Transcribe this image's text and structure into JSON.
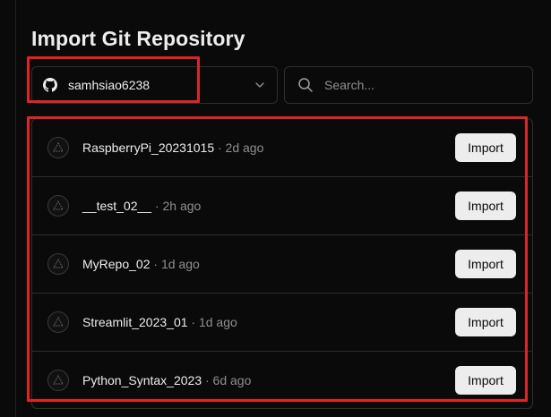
{
  "page": {
    "title": "Import Git Repository"
  },
  "account_select": {
    "value": "samhsiao6238",
    "icon": "github-icon"
  },
  "search": {
    "placeholder": "Search..."
  },
  "highlight_color": "#e02424",
  "repos": [
    {
      "name": "RaspberryPi_20231015",
      "meta": "· 2d ago",
      "button": "Import"
    },
    {
      "name": "__test_02__",
      "meta": "· 2h ago",
      "button": "Import"
    },
    {
      "name": "MyRepo_02",
      "meta": "· 1d ago",
      "button": "Import"
    },
    {
      "name": "Streamlit_2023_01",
      "meta": "· 1d ago",
      "button": "Import"
    },
    {
      "name": "Python_Syntax_2023",
      "meta": "· 6d ago",
      "button": "Import"
    }
  ]
}
